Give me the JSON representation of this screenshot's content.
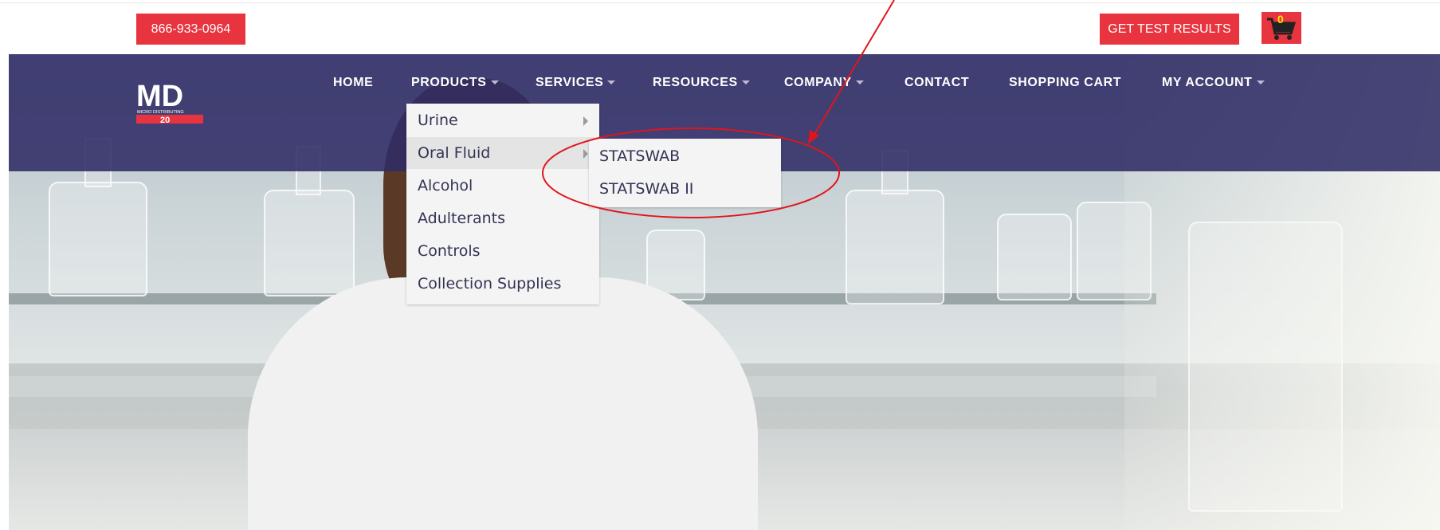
{
  "header": {
    "phone": "866-933-0964",
    "get_test_results": "GET TEST RESULTS",
    "cart_count": "0"
  },
  "logo": {
    "text": "MD",
    "subtext": "MICRO DISTRIBUTING",
    "anniversary": "20"
  },
  "nav": {
    "items": [
      {
        "label": "HOME"
      },
      {
        "label": "PRODUCTS"
      },
      {
        "label": "SERVICES"
      },
      {
        "label": "RESOURCES"
      },
      {
        "label": "COMPANY"
      },
      {
        "label": "CONTACT"
      },
      {
        "label": "SHOPPING CART"
      },
      {
        "label": "MY ACCOUNT"
      }
    ]
  },
  "products_menu": {
    "items": [
      {
        "label": "Urine"
      },
      {
        "label": "Oral Fluid"
      },
      {
        "label": "Alcohol"
      },
      {
        "label": "Adulterants"
      },
      {
        "label": "Controls"
      },
      {
        "label": "Collection Supplies"
      }
    ]
  },
  "oral_fluid_submenu": {
    "items": [
      {
        "label": "STATSWAB"
      },
      {
        "label": "STATSWAB II"
      }
    ]
  },
  "colors": {
    "accent_red": "#e8343e",
    "nav_bg": "#2f2b65",
    "annotation_red": "#e0151c"
  }
}
